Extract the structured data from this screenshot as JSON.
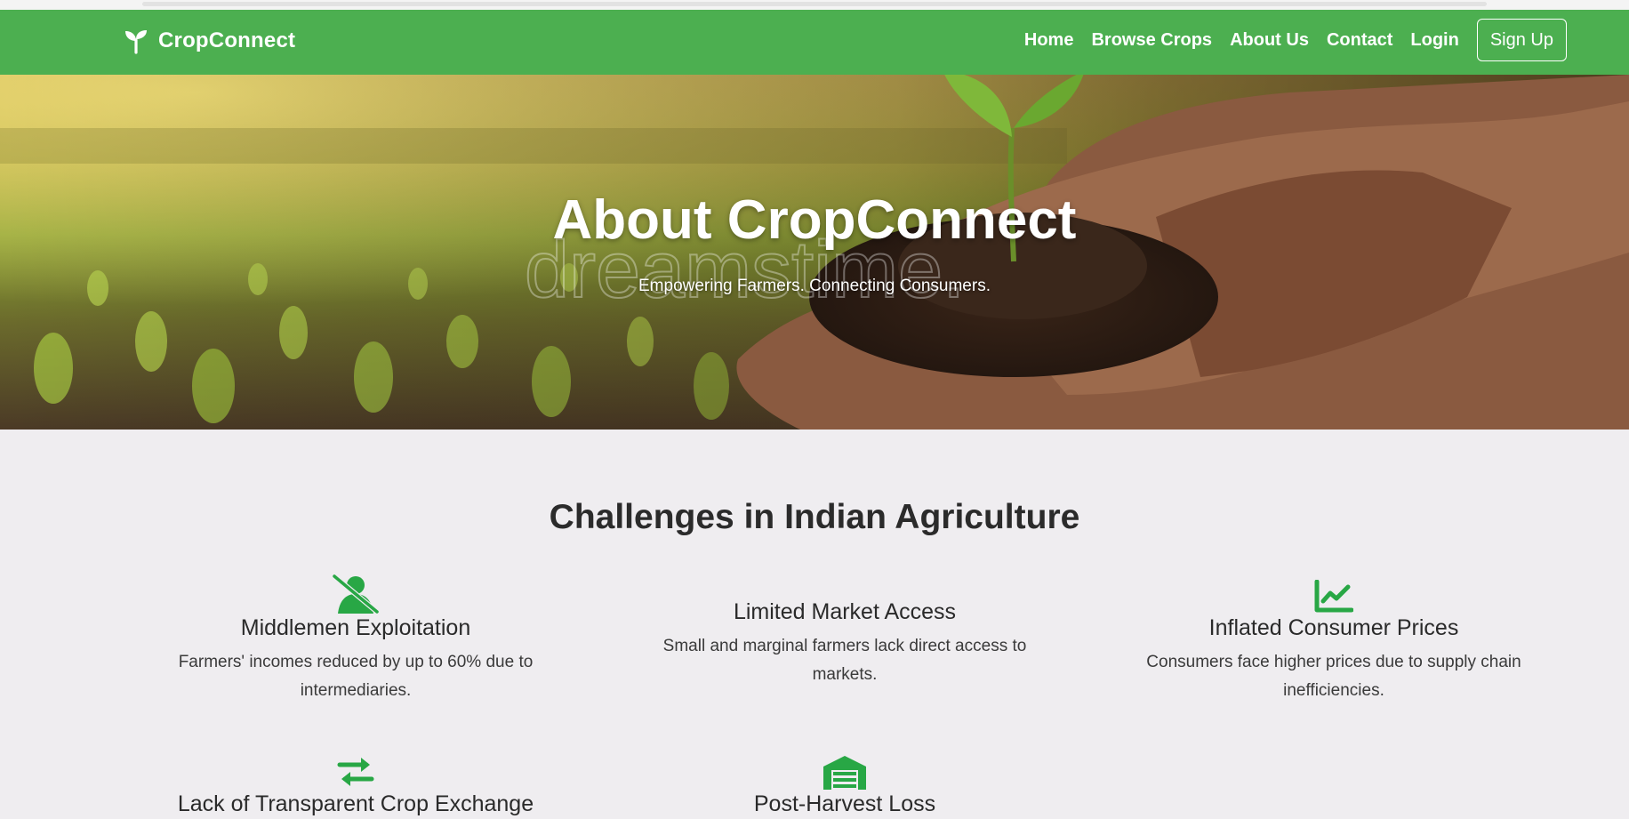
{
  "brand": {
    "name": "CropConnect",
    "icon": "seedling-icon"
  },
  "nav": {
    "links": [
      "Home",
      "Browse Crops",
      "About Us",
      "Contact",
      "Login"
    ],
    "signup": "Sign Up"
  },
  "hero": {
    "title": "About CropConnect",
    "subtitle": "Empowering Farmers. Connecting Consumers."
  },
  "challenges": {
    "title": "Challenges in Indian Agriculture",
    "items": [
      {
        "icon": "user-slash-icon",
        "title": "Middlemen Exploitation",
        "text": "Farmers' incomes reduced by up to 60% due to intermediaries."
      },
      {
        "icon": "",
        "title": "Limited Market Access",
        "text": "Small and marginal farmers lack direct access to markets."
      },
      {
        "icon": "chart-line-icon",
        "title": "Inflated Consumer Prices",
        "text": "Consumers face higher prices due to supply chain inefficiencies."
      },
      {
        "icon": "exchange-icon",
        "title": "Lack of Transparent Crop Exchange",
        "text": ""
      },
      {
        "icon": "warehouse-icon",
        "title": "Post-Harvest Loss",
        "text": ""
      }
    ]
  },
  "colors": {
    "primary": "#4caf50",
    "icon": "#28a745",
    "background": "#efedf0"
  }
}
